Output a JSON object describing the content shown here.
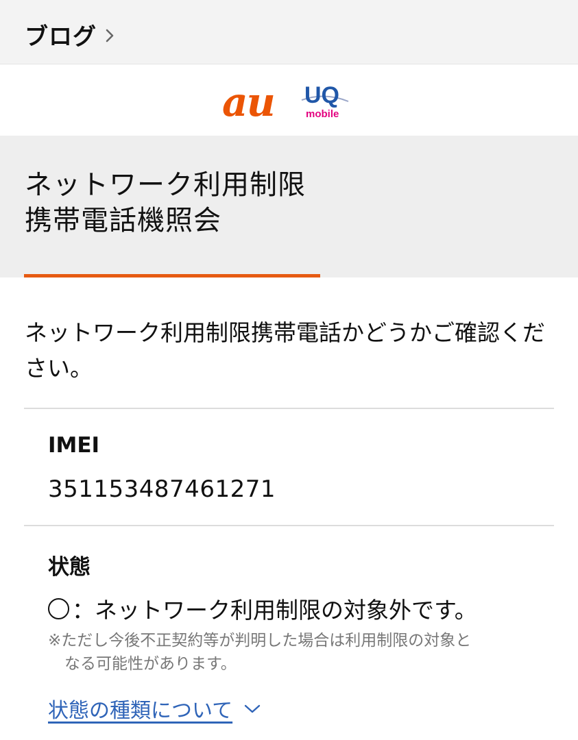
{
  "header": {
    "breadcrumb_label": "ブログ",
    "breadcrumb_icon": "chevron-right-icon"
  },
  "logos": {
    "au_text": "au",
    "uq_text": "UQ",
    "uq_sub": "mobile",
    "au_color": "#eb5505",
    "uq_color": "#2057a8",
    "uq_sub_color": "#e3007f"
  },
  "page": {
    "title_line1": "ネットワーク利用制限",
    "title_line2": "携帯電話機照会",
    "accent_color": "#e65a12",
    "intro": "ネットワーク利用制限携帯電話かどうかご確認ください。"
  },
  "imei": {
    "label": "IMEI",
    "value": "351153487461271"
  },
  "status": {
    "label": "状態",
    "symbol": "circle",
    "text": "：ネットワーク利用制限の対象外です。",
    "note_line1": "※ただし今後不正契約等が判明した場合は利用制限の対象と",
    "note_line2": "なる可能性があります。",
    "link_text": "状態の種類について",
    "link_icon": "chevron-down-icon",
    "link_color": "#2f64b8"
  }
}
